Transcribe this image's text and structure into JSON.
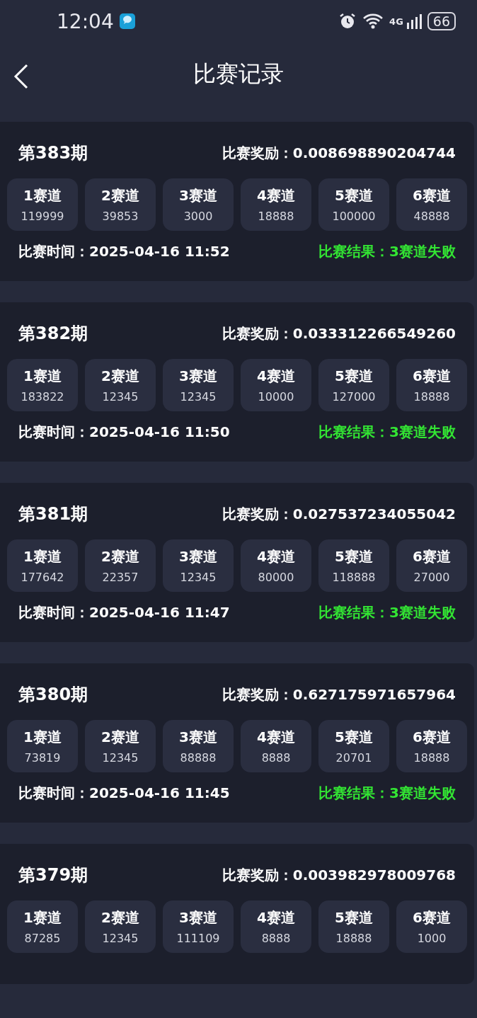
{
  "status_bar": {
    "time": "12:04",
    "network": "4G",
    "battery": "66"
  },
  "header": {
    "title": "比赛记录"
  },
  "records": [
    {
      "period": "第383期",
      "reward_label": "比赛奖励：",
      "reward": "0.008698890204744",
      "lanes": [
        {
          "name": "1赛道",
          "value": "119999"
        },
        {
          "name": "2赛道",
          "value": "39853"
        },
        {
          "name": "3赛道",
          "value": "3000"
        },
        {
          "name": "4赛道",
          "value": "18888"
        },
        {
          "name": "5赛道",
          "value": "100000"
        },
        {
          "name": "6赛道",
          "value": "48888"
        }
      ],
      "time_label": "比赛时间：",
      "time": "2025-04-16 11:52",
      "result": "比赛结果：3赛道失败"
    },
    {
      "period": "第382期",
      "reward_label": "比赛奖励：",
      "reward": "0.033312266549260",
      "lanes": [
        {
          "name": "1赛道",
          "value": "183822"
        },
        {
          "name": "2赛道",
          "value": "12345"
        },
        {
          "name": "3赛道",
          "value": "12345"
        },
        {
          "name": "4赛道",
          "value": "10000"
        },
        {
          "name": "5赛道",
          "value": "127000"
        },
        {
          "name": "6赛道",
          "value": "18888"
        }
      ],
      "time_label": "比赛时间：",
      "time": "2025-04-16 11:50",
      "result": "比赛结果：3赛道失败"
    },
    {
      "period": "第381期",
      "reward_label": "比赛奖励：",
      "reward": "0.027537234055042",
      "lanes": [
        {
          "name": "1赛道",
          "value": "177642"
        },
        {
          "name": "2赛道",
          "value": "22357"
        },
        {
          "name": "3赛道",
          "value": "12345"
        },
        {
          "name": "4赛道",
          "value": "80000"
        },
        {
          "name": "5赛道",
          "value": "118888"
        },
        {
          "name": "6赛道",
          "value": "27000"
        }
      ],
      "time_label": "比赛时间：",
      "time": "2025-04-16 11:47",
      "result": "比赛结果：3赛道失败"
    },
    {
      "period": "第380期",
      "reward_label": "比赛奖励：",
      "reward": "0.627175971657964",
      "lanes": [
        {
          "name": "1赛道",
          "value": "73819"
        },
        {
          "name": "2赛道",
          "value": "12345"
        },
        {
          "name": "3赛道",
          "value": "88888"
        },
        {
          "name": "4赛道",
          "value": "8888"
        },
        {
          "name": "5赛道",
          "value": "20701"
        },
        {
          "name": "6赛道",
          "value": "18888"
        }
      ],
      "time_label": "比赛时间：",
      "time": "2025-04-16 11:45",
      "result": "比赛结果：3赛道失败"
    },
    {
      "period": "第379期",
      "reward_label": "比赛奖励：",
      "reward": "0.003982978009768",
      "lanes": [
        {
          "name": "1赛道",
          "value": "87285"
        },
        {
          "name": "2赛道",
          "value": "12345"
        },
        {
          "name": "3赛道",
          "value": "111109"
        },
        {
          "name": "4赛道",
          "value": "8888"
        },
        {
          "name": "5赛道",
          "value": "18888"
        },
        {
          "name": "6赛道",
          "value": "1000"
        }
      ]
    }
  ]
}
